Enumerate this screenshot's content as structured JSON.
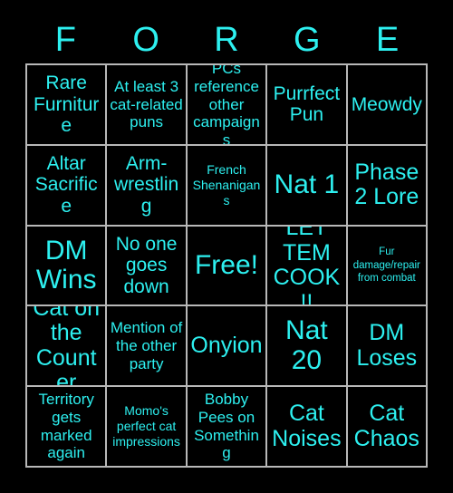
{
  "card": {
    "title": "FORGE",
    "colors": {
      "background": "#000000",
      "text": "#2df0f0",
      "gridline": "#b8b8b8"
    }
  },
  "header": {
    "letters": [
      {
        "label": "F"
      },
      {
        "label": "O"
      },
      {
        "label": "R"
      },
      {
        "label": "G"
      },
      {
        "label": "E"
      }
    ]
  },
  "grid": {
    "rows": 5,
    "columns": 5,
    "cells": [
      {
        "label": "Rare Furniture",
        "size": "lg",
        "free": false,
        "row": 1,
        "col": 1
      },
      {
        "label": "At least 3 cat-related puns",
        "size": "md",
        "free": false,
        "row": 1,
        "col": 2
      },
      {
        "label": "PCs reference other campaigns",
        "size": "md",
        "free": false,
        "row": 1,
        "col": 3
      },
      {
        "label": "Purrfect Pun",
        "size": "lg",
        "free": false,
        "row": 1,
        "col": 4
      },
      {
        "label": "Meowdy",
        "size": "lg",
        "free": false,
        "row": 1,
        "col": 5
      },
      {
        "label": "Altar Sacrifice",
        "size": "lg",
        "free": false,
        "row": 2,
        "col": 1
      },
      {
        "label": "Arm-wrestling",
        "size": "lg",
        "free": false,
        "row": 2,
        "col": 2
      },
      {
        "label": "French Shenanigans",
        "size": "sm",
        "free": false,
        "row": 2,
        "col": 3
      },
      {
        "label": "Nat 1",
        "size": "xxl",
        "free": false,
        "row": 2,
        "col": 4
      },
      {
        "label": "Phase 2 Lore",
        "size": "xl",
        "free": false,
        "row": 2,
        "col": 5
      },
      {
        "label": "DM Wins",
        "size": "xxl",
        "free": false,
        "row": 3,
        "col": 1
      },
      {
        "label": "No one goes down",
        "size": "lg",
        "free": false,
        "row": 3,
        "col": 2
      },
      {
        "label": "Free!",
        "size": "xxl",
        "free": true,
        "row": 3,
        "col": 3
      },
      {
        "label": "LET TEM COOK!!",
        "size": "xl",
        "free": false,
        "row": 3,
        "col": 4
      },
      {
        "label": "Fur damage/repair from combat",
        "size": "xs",
        "free": false,
        "row": 3,
        "col": 5
      },
      {
        "label": "Cat on the Counter",
        "size": "xl",
        "free": false,
        "row": 4,
        "col": 1
      },
      {
        "label": "Mention of the other party",
        "size": "md",
        "free": false,
        "row": 4,
        "col": 2
      },
      {
        "label": "Onyion",
        "size": "xl",
        "free": false,
        "row": 4,
        "col": 3
      },
      {
        "label": "Nat 20",
        "size": "xxl",
        "free": false,
        "row": 4,
        "col": 4
      },
      {
        "label": "DM Loses",
        "size": "xl",
        "free": false,
        "row": 4,
        "col": 5
      },
      {
        "label": "Territory gets marked again",
        "size": "md",
        "free": false,
        "row": 5,
        "col": 1
      },
      {
        "label": "Momo's perfect cat impressions",
        "size": "sm",
        "free": false,
        "row": 5,
        "col": 2
      },
      {
        "label": "Bobby Pees on Something",
        "size": "md",
        "free": false,
        "row": 5,
        "col": 3
      },
      {
        "label": "Cat Noises",
        "size": "xl",
        "free": false,
        "row": 5,
        "col": 4
      },
      {
        "label": "Cat Chaos",
        "size": "xl",
        "free": false,
        "row": 5,
        "col": 5
      }
    ]
  }
}
